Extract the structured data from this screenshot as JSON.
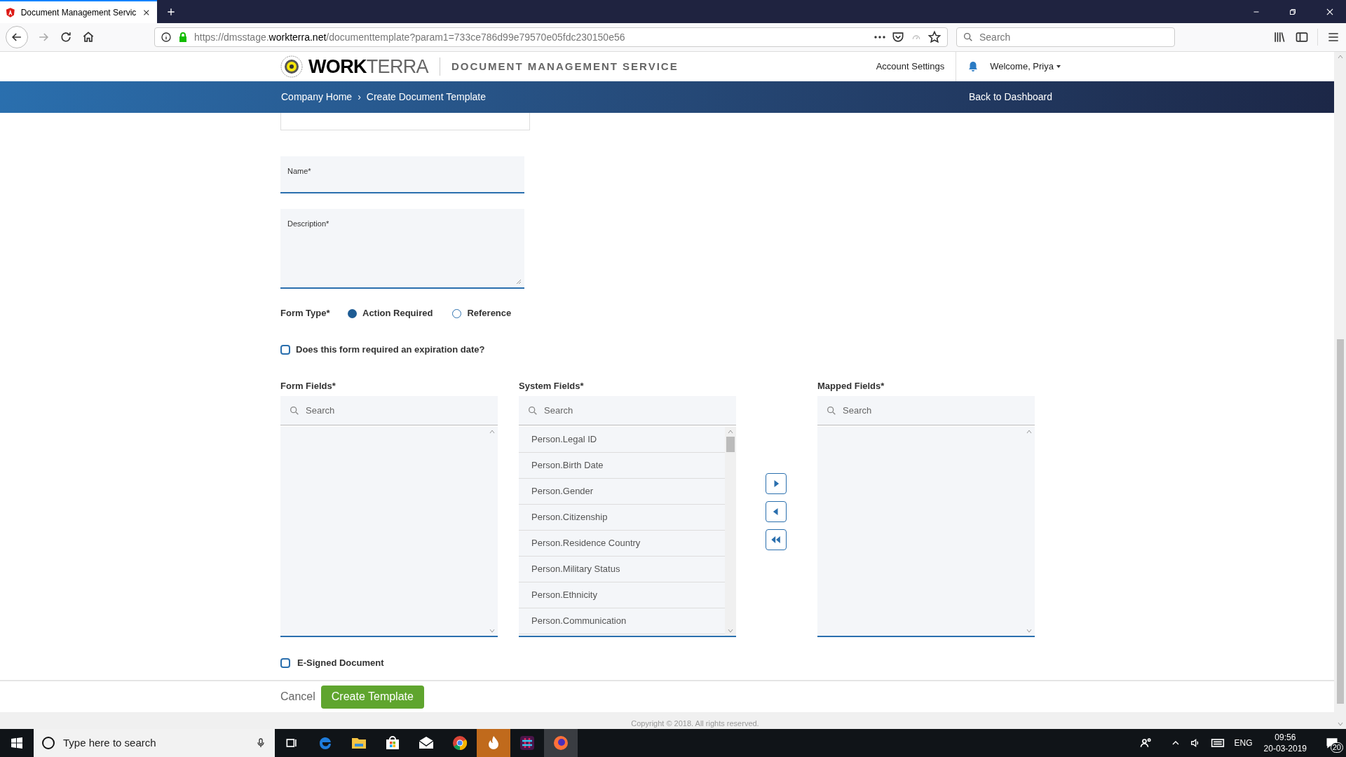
{
  "browser": {
    "tab_title": "Document Management Servic",
    "url_prefix": "https://dmsstage.",
    "url_domain": "workterra.net",
    "url_path": "/documenttemplate?param1=733ce786d99e79570e05fdc230150e56",
    "search_placeholder": "Search"
  },
  "header": {
    "logo_bold": "WORK",
    "logo_light": "TERRA",
    "service": "DOCUMENT MANAGEMENT SERVICE",
    "account_settings": "Account Settings",
    "welcome": "Welcome, Priya"
  },
  "breadcrumb": {
    "items": [
      "Company Home",
      "Create Document Template"
    ],
    "separator": "›",
    "back": "Back to Dashboard"
  },
  "form": {
    "name_label": "Name*",
    "description_label": "Description*",
    "form_type_label": "Form Type*",
    "form_types": [
      {
        "label": "Action Required",
        "selected": true
      },
      {
        "label": "Reference",
        "selected": false
      }
    ],
    "expiration": {
      "label": "Does this form required an expiration date?",
      "checked": false
    },
    "lists": [
      {
        "label": "Form Fields*",
        "placeholder": "Search"
      },
      {
        "label": "System Fields*",
        "placeholder": "Search",
        "items": [
          "Person.Legal ID",
          "Person.Birth Date",
          "Person.Gender",
          "Person.Citizenship",
          "Person.Residence Country",
          "Person.Military Status",
          "Person.Ethnicity",
          "Person.Communication"
        ]
      },
      {
        "label": "Mapped Fields*",
        "placeholder": "Search"
      }
    ],
    "esigned": {
      "label": "E-Signed Document",
      "checked": false
    }
  },
  "footer": {
    "cancel": "Cancel",
    "create": "Create Template",
    "copyright": "Copyright © 2018. All rights reserved."
  },
  "taskbar": {
    "search_placeholder": "Type here to search",
    "language": "ENG",
    "time": "09:56",
    "date": "20-03-2019",
    "notifications": "20"
  }
}
